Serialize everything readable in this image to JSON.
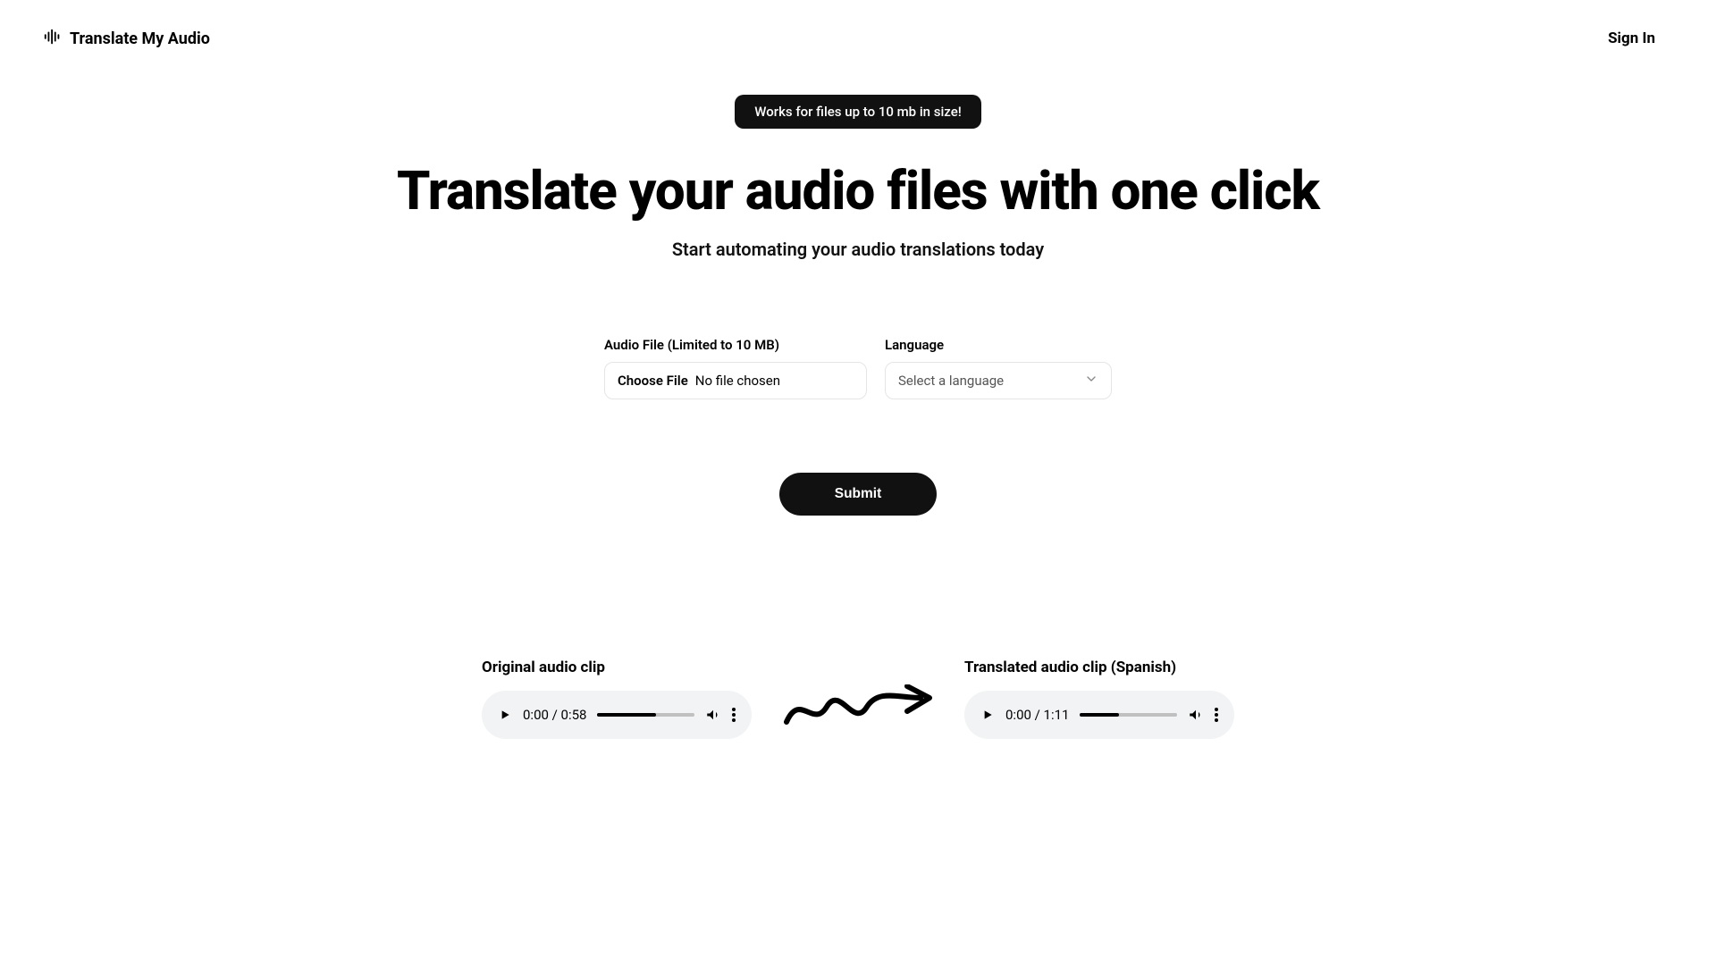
{
  "header": {
    "logo_text": "Translate My Audio",
    "signin": "Sign In"
  },
  "pill": "Works for files up to 10 mb in size!",
  "hero": {
    "title": "Translate your audio files with one click",
    "subtitle": "Start automating your audio translations today"
  },
  "form": {
    "file_label": "Audio File (Limited to 10 MB)",
    "file_button": "Choose File",
    "file_placeholder": "No file chosen",
    "lang_label": "Language",
    "lang_placeholder": "Select a language",
    "submit": "Submit"
  },
  "clips": {
    "original_label": "Original audio clip",
    "translated_label": "Translated audio clip (Spanish)",
    "original_time": "0:00 / 0:58",
    "translated_time": "0:00 / 1:11"
  }
}
